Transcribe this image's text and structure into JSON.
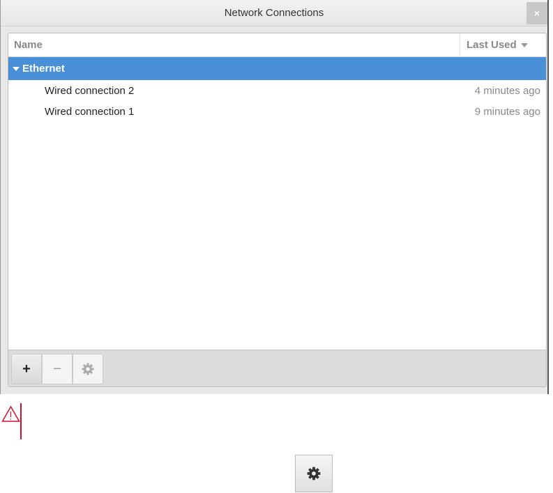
{
  "window": {
    "title": "Network Connections",
    "close_label": "×"
  },
  "list": {
    "columns": {
      "name": "Name",
      "last_used": "Last Used"
    },
    "groups": [
      {
        "label": "Ethernet",
        "items": [
          {
            "name": "Wired connection 2",
            "last_used": "4 minutes ago"
          },
          {
            "name": "Wired connection 1",
            "last_used": "9 minutes ago"
          }
        ]
      }
    ]
  },
  "toolbar": {
    "add": "+",
    "remove": "−"
  },
  "colors": {
    "selection": "#4a90d9",
    "warning": "#d0102a"
  }
}
